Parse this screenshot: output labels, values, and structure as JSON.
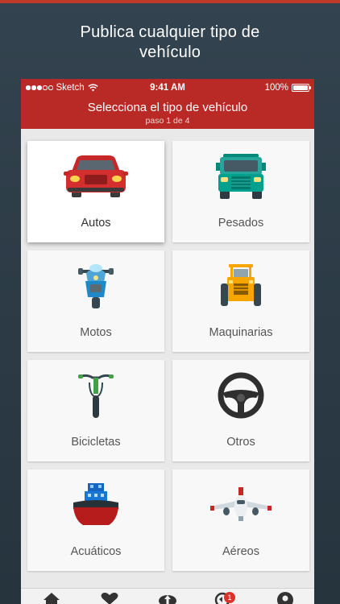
{
  "headline": {
    "line1": "Publica cualquier tipo de",
    "line2": "vehículo"
  },
  "status_bar": {
    "carrier": "Sketch",
    "time": "9:41 AM",
    "battery": "100%",
    "battery_level": 1.0
  },
  "nav": {
    "title": "Selecciona el tipo de vehículo",
    "step": "paso 1 de 4"
  },
  "categories": [
    {
      "label": "Autos",
      "icon": "car-icon",
      "selected": true
    },
    {
      "label": "Pesados",
      "icon": "truck-icon",
      "selected": false
    },
    {
      "label": "Motos",
      "icon": "scooter-icon",
      "selected": false
    },
    {
      "label": "Maquinarias",
      "icon": "tractor-icon",
      "selected": false
    },
    {
      "label": "Bicicletas",
      "icon": "bicycle-icon",
      "selected": false
    },
    {
      "label": "Otros",
      "icon": "steering-wheel-icon",
      "selected": false
    },
    {
      "label": "Acuáticos",
      "icon": "boat-icon",
      "selected": false
    },
    {
      "label": "Aéreos",
      "icon": "airplane-icon",
      "selected": false
    }
  ],
  "tab_bar": {
    "items": [
      "home-icon",
      "heart-icon",
      "upload-icon",
      "messages-icon",
      "profile-icon"
    ],
    "messages_badge": "1"
  },
  "colors": {
    "brand_red": "#b92a26",
    "background": "#2e3d48"
  }
}
